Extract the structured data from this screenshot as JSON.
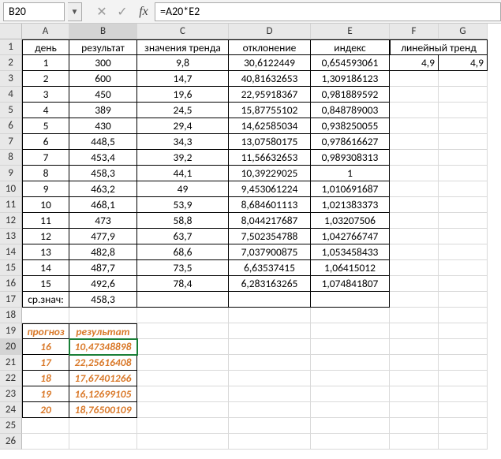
{
  "name_box": "B20",
  "formula": "=A20*E2",
  "col_letters": [
    "A",
    "B",
    "C",
    "D",
    "E",
    "F",
    "G"
  ],
  "active_col": "B",
  "active_row": 20,
  "headers": {
    "A": "день",
    "B": "результат",
    "C": "значения тренда",
    "D": "отклонение",
    "E": "индекс",
    "FG": "линейный тренд"
  },
  "data_rows": [
    {
      "A": "1",
      "B": "300",
      "C": "9,8",
      "D": "30,6122449",
      "E": "0,654593061",
      "F": "4,9",
      "G": "4,9"
    },
    {
      "A": "2",
      "B": "600",
      "C": "14,7",
      "D": "40,81632653",
      "E": "1,309186123",
      "F": "",
      "G": ""
    },
    {
      "A": "3",
      "B": "450",
      "C": "19,6",
      "D": "22,95918367",
      "E": "0,981889592",
      "F": "",
      "G": ""
    },
    {
      "A": "4",
      "B": "389",
      "C": "24,5",
      "D": "15,87755102",
      "E": "0,848789003",
      "F": "",
      "G": ""
    },
    {
      "A": "5",
      "B": "430",
      "C": "29,4",
      "D": "14,62585034",
      "E": "0,938250055",
      "F": "",
      "G": ""
    },
    {
      "A": "6",
      "B": "448,5",
      "C": "34,3",
      "D": "13,07580175",
      "E": "0,978616627",
      "F": "",
      "G": ""
    },
    {
      "A": "7",
      "B": "453,4",
      "C": "39,2",
      "D": "11,56632653",
      "E": "0,989308313",
      "F": "",
      "G": ""
    },
    {
      "A": "8",
      "B": "458,3",
      "C": "44,1",
      "D": "10,39229025",
      "E": "1",
      "F": "",
      "G": ""
    },
    {
      "A": "9",
      "B": "463,2",
      "C": "49",
      "D": "9,453061224",
      "E": "1,010691687",
      "F": "",
      "G": ""
    },
    {
      "A": "10",
      "B": "468,1",
      "C": "53,9",
      "D": "8,684601113",
      "E": "1,021383373",
      "F": "",
      "G": ""
    },
    {
      "A": "11",
      "B": "473",
      "C": "58,8",
      "D": "8,044217687",
      "E": "1,03207506",
      "F": "",
      "G": ""
    },
    {
      "A": "12",
      "B": "477,9",
      "C": "63,7",
      "D": "7,502354788",
      "E": "1,042766747",
      "F": "",
      "G": ""
    },
    {
      "A": "13",
      "B": "482,8",
      "C": "68,6",
      "D": "7,037900875",
      "E": "1,053458433",
      "F": "",
      "G": ""
    },
    {
      "A": "14",
      "B": "487,7",
      "C": "73,5",
      "D": "6,63537415",
      "E": "1,06415012",
      "F": "",
      "G": ""
    },
    {
      "A": "15",
      "B": "492,6",
      "C": "78,4",
      "D": "6,283163265",
      "E": "1,074841807",
      "F": "",
      "G": ""
    }
  ],
  "avg_label": "ср.знач:",
  "avg_value": "458,3",
  "forecast_h": {
    "A": "прогноз",
    "B": "результат"
  },
  "forecast_rows": [
    {
      "A": "16",
      "B": "10,47348898"
    },
    {
      "A": "17",
      "B": "22,25616408"
    },
    {
      "A": "18",
      "B": "17,67401266"
    },
    {
      "A": "19",
      "B": "16,12699105"
    },
    {
      "A": "20",
      "B": "18,76500109"
    }
  ]
}
